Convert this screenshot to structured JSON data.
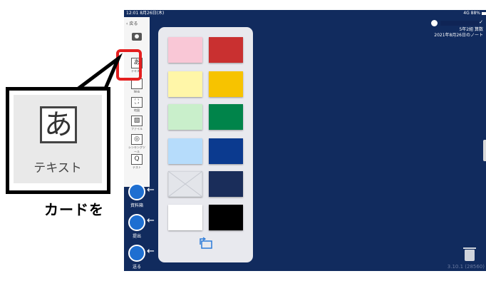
{
  "status_bar": {
    "time": "12:01 8月26日(木)",
    "signal_battery": "4G 88%"
  },
  "header": {
    "class_name": "5年2組 算数",
    "note_title": "2021年8月26日のノート"
  },
  "sidebar": {
    "back_label": "戻る",
    "tools": [
      {
        "icon": "text-icon",
        "glyph": "あ",
        "label": "テキスト"
      },
      {
        "icon": "web-icon",
        "glyph": "",
        "label": "Web"
      },
      {
        "icon": "map-icon",
        "glyph": "",
        "label": "地図"
      },
      {
        "icon": "file-icon",
        "glyph": "",
        "label": "ファイル"
      },
      {
        "icon": "thinking-tool-icon",
        "glyph": "",
        "label": "シンキングツール"
      },
      {
        "icon": "test-icon",
        "glyph": "Q",
        "label": "テスト"
      }
    ],
    "actions": [
      {
        "icon": "materials-box-icon",
        "label": "資料箱"
      },
      {
        "icon": "submit-icon",
        "label": "提出"
      },
      {
        "icon": "send-icon",
        "label": "送る"
      }
    ]
  },
  "palette": {
    "colors": [
      "#f9c7d6",
      "#c93030",
      "#fff6a8",
      "#f7c300",
      "#c9efcb",
      "#00844a",
      "#b6dcfb",
      "#0b3a8f",
      "#none",
      "#1a2d5a",
      "#ffffff",
      "#000000"
    ]
  },
  "callout": {
    "glyph": "あ",
    "label": "テキスト"
  },
  "caption": "カードを",
  "version": "3.10.1 (28560)"
}
